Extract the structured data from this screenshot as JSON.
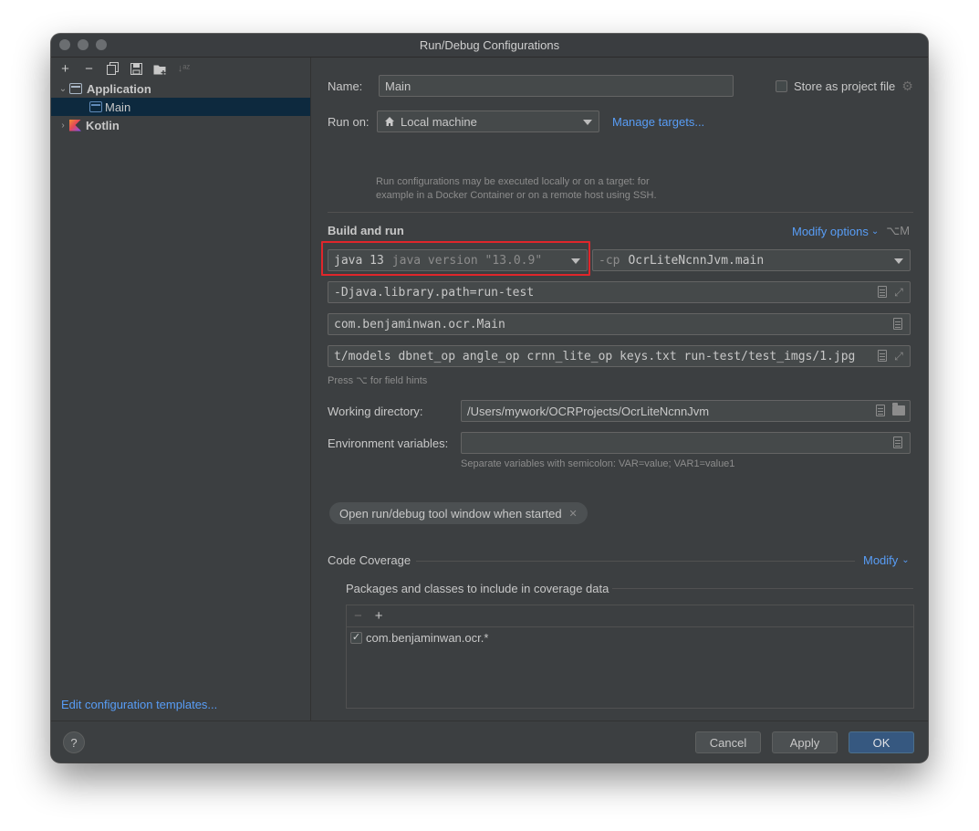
{
  "window": {
    "title": "Run/Debug Configurations"
  },
  "sidebar": {
    "toolbar": [
      "+",
      "−",
      "copy",
      "save",
      "folder",
      "sort"
    ],
    "tree": [
      {
        "label": "Application",
        "expanded": true,
        "icon": "application-icon"
      },
      {
        "label": "Main",
        "selected": true,
        "icon": "main-config-icon"
      },
      {
        "label": "Kotlin",
        "expanded": false,
        "icon": "kotlin-icon"
      }
    ],
    "edit_templates": "Edit configuration templates..."
  },
  "form": {
    "name_label": "Name:",
    "name_value": "Main",
    "store_as_project_file": "Store as project file",
    "store_checked": false,
    "run_on_label": "Run on:",
    "run_on_value": "Local machine",
    "manage_targets": "Manage targets...",
    "run_on_hint_1": "Run configurations may be executed locally or on a target: for",
    "run_on_hint_2": "example in a Docker Container or on a remote host using SSH.",
    "build_and_run": "Build and run",
    "modify_options": "Modify options",
    "modify_shortcut": "⌥M",
    "jre_main": "java 13",
    "jre_detail": "java version \"13.0.9\"",
    "cp_prefix": "-cp",
    "cp_value": "OcrLiteNcnnJvm.main",
    "vm_options": "-Djava.library.path=run-test",
    "main_class": "com.benjaminwan.ocr.Main",
    "program_args": "t/models dbnet_op angle_op crnn_lite_op keys.txt run-test/test_imgs/1.jpg",
    "field_hint": "Press ⌥ for field hints",
    "working_dir_label": "Working directory:",
    "working_dir_value": "/Users/mywork/OCRProjects/OcrLiteNcnnJvm",
    "env_label": "Environment variables:",
    "env_value": "",
    "env_hint": "Separate variables with semicolon: VAR=value; VAR1=value1",
    "open_tool_window_chip": "Open run/debug tool window when started",
    "code_coverage": "Code Coverage",
    "modify": "Modify",
    "packages_label": "Packages and classes to include in coverage data",
    "coverage_items": [
      {
        "label": "com.benjaminwan.ocr.*",
        "checked": true
      }
    ]
  },
  "footer": {
    "help": "?",
    "cancel": "Cancel",
    "apply": "Apply",
    "ok": "OK"
  },
  "colors": {
    "background": "#3c3f41",
    "selection": "#0d293e",
    "link": "#589df6",
    "primary_button": "#365880",
    "highlight_box": "#e0262b"
  }
}
